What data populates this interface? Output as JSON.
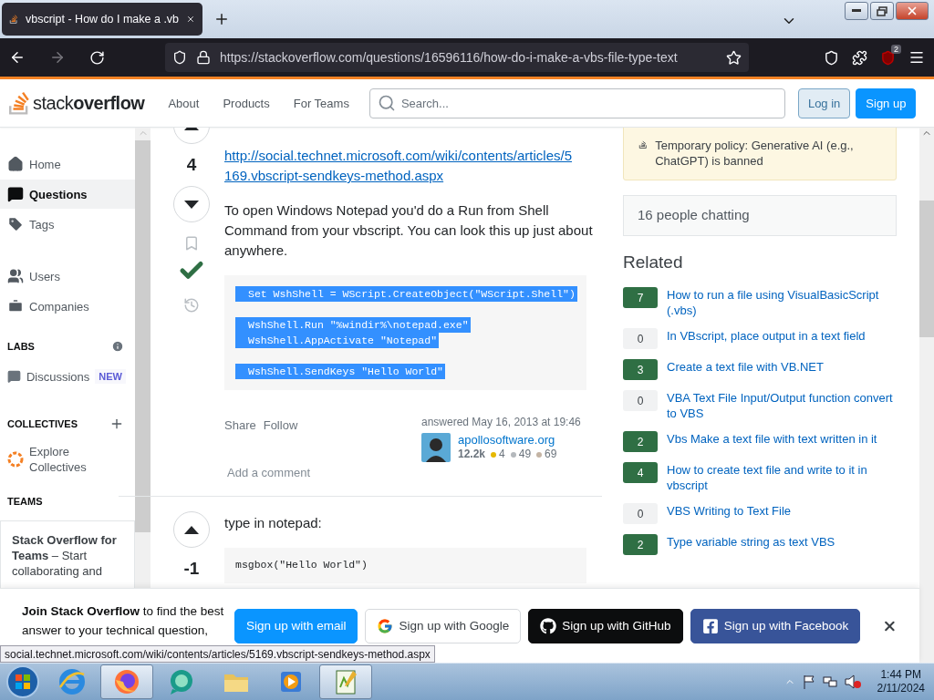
{
  "browser": {
    "tab_title": "vbscript - How do I make a .vb",
    "url": "https://stackoverflow.com/questions/16596116/how-do-i-make-a-vbs-file-type-text",
    "extension_badge": "2"
  },
  "header": {
    "logo": "stack**overflow**",
    "nav": [
      "About",
      "Products",
      "For Teams"
    ],
    "search_placeholder": "Search...",
    "login": "Log in",
    "signup": "Sign up"
  },
  "sidebar": {
    "items": [
      {
        "kind": "home",
        "label": "Home",
        "selected": false
      },
      {
        "kind": "questions",
        "label": "Questions",
        "selected": true
      },
      {
        "kind": "tags",
        "label": "Tags",
        "selected": false
      },
      {
        "kind": "users",
        "label": "Users",
        "selected": false
      },
      {
        "kind": "companies",
        "label": "Companies",
        "selected": false
      }
    ],
    "labs": {
      "heading": "LABS",
      "item": "Discussions",
      "badge": "NEW"
    },
    "collectives": {
      "heading": "COLLECTIVES",
      "item": "Explore Collectives"
    },
    "teams": {
      "heading": "TEAMS",
      "text": "**Stack Overflow for Teams** – Start collaborating and"
    }
  },
  "answer": {
    "score": "4",
    "accepted": true,
    "link": "http://social.technet.microsoft.com/wiki/contents/articles/5169.vbscript-sendkeys-method.aspx",
    "text": "To open Windows Notepad you'd do a Run from Shell Command from your vbscript. You can look this up just about anywhere.",
    "code_selected": true,
    "code": [
      [
        "Set WshShell = WScript.CreateObject(\"WScript.Shell\")"
      ],
      [
        "WshShell.Run \"%windir%\\notepad.exe\"",
        "WshShell.AppActivate \"Notepad\""
      ],
      [
        "WshShell.SendKeys \"Hello World\""
      ]
    ],
    "actions": [
      "Share",
      "Follow"
    ],
    "answered": "answered May 16, 2013 at 19:46",
    "user": "apollosoftware.org",
    "reputation": "12.2k",
    "badges": [
      {
        "count": "4",
        "color": "#e6b800"
      },
      {
        "count": "49",
        "color": "#b4b8bc"
      },
      {
        "count": "69",
        "color": "#c4b4a4"
      }
    ],
    "add_comment": "Add a comment"
  },
  "answer2": {
    "score": "-1",
    "text": "type in notepad:",
    "code": "msgbox(\"Hello World\")"
  },
  "right": {
    "notice": "Temporary policy: Generative AI (e.g., ChatGPT) is banned",
    "chat": "16 people chatting",
    "related_heading": "Related",
    "related": [
      {
        "score": "7",
        "title": "How to run a file using VisualBasicScript (.vbs)",
        "accepted": true
      },
      {
        "score": "0",
        "title": "In VBscript, place output in a text field",
        "accepted": false
      },
      {
        "score": "3",
        "title": "Create a text file with VB.NET",
        "accepted": true
      },
      {
        "score": "0",
        "title": "VBA Text File Input/Output function convert to VBS",
        "accepted": false
      },
      {
        "score": "2",
        "title": "Vbs Make a text file with text written in it",
        "accepted": true
      },
      {
        "score": "4",
        "title": "How to create text file and write to it in vbscript",
        "accepted": true
      },
      {
        "score": "0",
        "title": "VBS Writing to Text File",
        "accepted": false
      },
      {
        "score": "2",
        "title": "Type variable string as text VBS",
        "accepted": true
      }
    ]
  },
  "banner": {
    "text": "**Join Stack Overflow** to find the best answer to your technical question,",
    "buttons": [
      {
        "kind": "email",
        "label": "Sign up with email"
      },
      {
        "kind": "google",
        "label": "Sign up with Google"
      },
      {
        "kind": "github",
        "label": "Sign up with GitHub"
      },
      {
        "kind": "facebook",
        "label": "Sign up with Facebook"
      }
    ]
  },
  "status_link": "social.technet.microsoft.com/wiki/contents/articles/5169.vbscript-sendkeys-method.aspx",
  "taskbar": {
    "apps": [
      {
        "kind": "ie",
        "active": false
      },
      {
        "kind": "firefox",
        "active": true
      },
      {
        "kind": "chat",
        "active": false
      },
      {
        "kind": "folder",
        "active": false
      },
      {
        "kind": "media",
        "active": false
      },
      {
        "kind": "notepad",
        "active": true
      }
    ],
    "time": "1:44 PM",
    "date": "2/11/2024"
  }
}
